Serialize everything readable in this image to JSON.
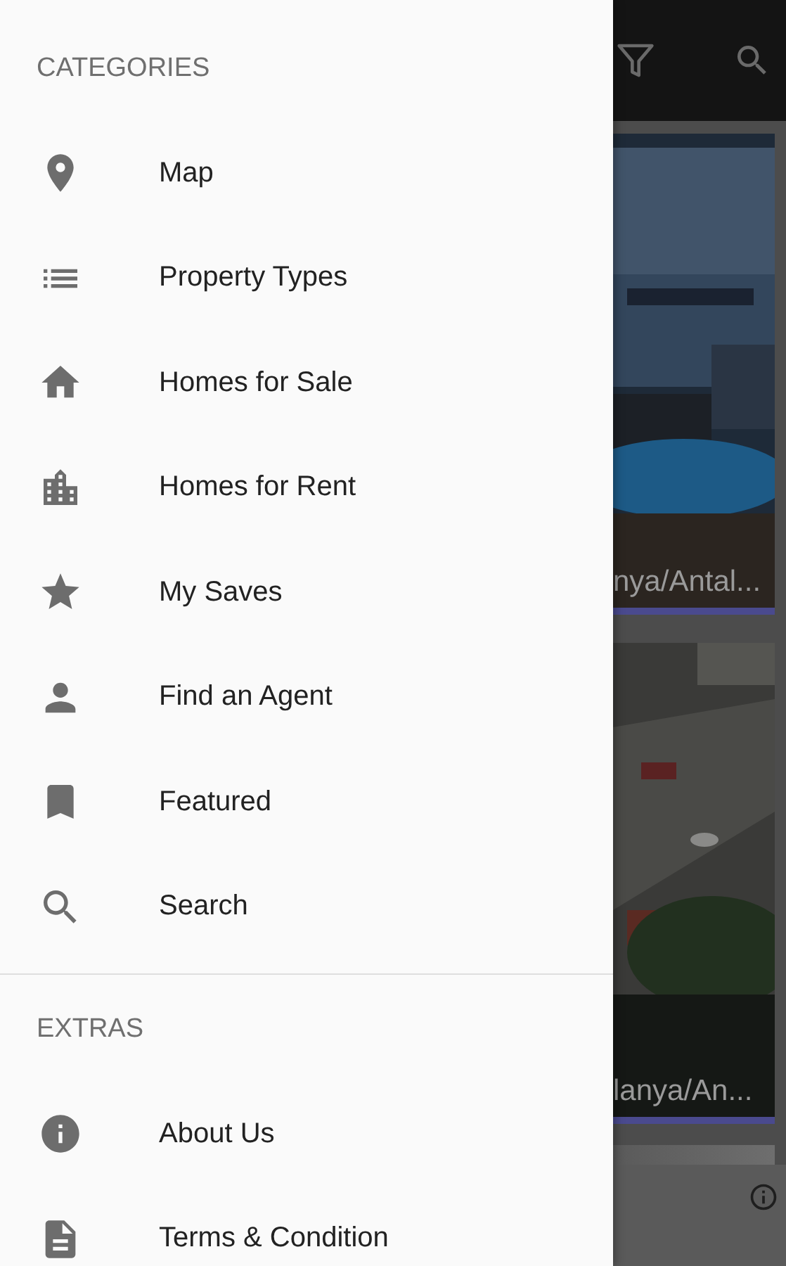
{
  "drawer": {
    "sections": [
      {
        "header": "CATEGORIES",
        "items": [
          {
            "label": "Map"
          },
          {
            "label": "Property Types"
          },
          {
            "label": "Homes for Sale"
          },
          {
            "label": "Homes for Rent"
          },
          {
            "label": "My Saves"
          },
          {
            "label": "Find an Agent"
          },
          {
            "label": "Featured"
          },
          {
            "label": "Search"
          }
        ]
      },
      {
        "header": "EXTRAS",
        "items": [
          {
            "label": "About Us"
          },
          {
            "label": "Terms & Condition"
          }
        ]
      }
    ]
  },
  "listings": [
    {
      "caption": "nya/Antal...",
      "kind": "building"
    },
    {
      "caption": "lanya/An...",
      "kind": "aerial"
    }
  ]
}
